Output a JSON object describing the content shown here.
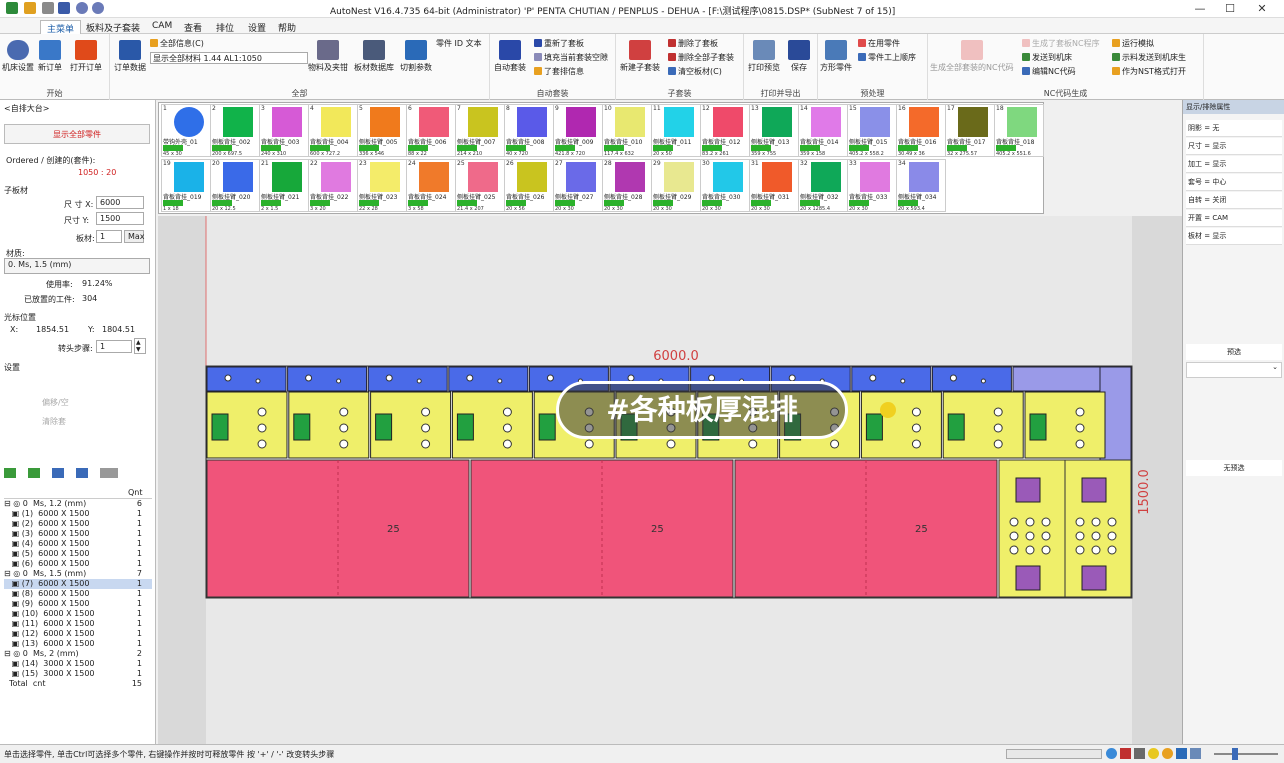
{
  "window": {
    "title": "AutoNest V16.4.735 64-bit (Administrator)  'P'  PENTA  CHUTIAN / PENPLUS        - DEHUA - [F:\\测试程序\\0815.DSP* (SubNest 7 of 15)]"
  },
  "tabs": [
    "主菜单",
    "板料及子套装",
    "CAM",
    "查看",
    "排位",
    "设置",
    "帮助"
  ],
  "ribbon": {
    "start": {
      "label": "开始",
      "buttons": [
        "机床设置",
        "新订单",
        "打开订单"
      ]
    },
    "all": {
      "label": "全部",
      "order_data": "订单数据",
      "all_info": "全部信息(C)",
      "combo_value": "显示全部材料    1.44 AL1:1050",
      "buttons": [
        "物料及夹钳",
        "板材数据库",
        "切割参数"
      ],
      "part_id": "零件 ID 文本"
    },
    "autonest": {
      "label": "自动套装",
      "big": "自动套装",
      "items": [
        "重新了套板",
        "填充当前套装空隙",
        "了套排信息"
      ]
    },
    "subnest": {
      "label": "子套装",
      "big": "新建子套装",
      "items": [
        "删除了套板",
        "删除全部子套装",
        "清空板材(C)"
      ]
    },
    "print": {
      "label": "打印并导出",
      "buttons": [
        "打印预览",
        "保存"
      ]
    },
    "preprocess": {
      "label": "预处理",
      "big": "方形零件",
      "items": [
        "在用零件",
        "零件工上顺序"
      ]
    },
    "nc": {
      "label": "NC代码生成",
      "big": "生成全部套装的NC代码",
      "items": [
        "生成了套板NC程序",
        "发送到机床",
        "编辑NC代码",
        "运行模拟",
        "示料发送到机床生",
        "作为NST格式打开"
      ]
    }
  },
  "left": {
    "header": "<自排大台>",
    "red_button": "显示全部零件",
    "ordered_label": "Ordered / 创建的(套件):",
    "ordered_value": "1050 : 20",
    "sheet_section": "子板材",
    "size_x_label": "尺 寸 X:",
    "size_x": "6000",
    "size_y_label": "尺寸 Y:",
    "size_y": "1500",
    "material_label": "板材:",
    "material": "1",
    "max_btn": "Max",
    "material_section": "材质:",
    "material_value": "0. Ms, 1.5 (mm)",
    "usage_label": "使用率:",
    "usage": "91.24%",
    "placed_label": "已放置的工件:",
    "placed": "304",
    "cursor_section": "光标位置",
    "x_label": "X:",
    "x": "1854.51",
    "y_label": "Y:",
    "y": "1804.51",
    "step_label": "转头步骤:",
    "step": "1",
    "settings_section": "设置",
    "grey1": "偏移/空",
    "grey2": "清除套",
    "tree_header": "Qnt",
    "tree": [
      {
        "t": "⊟ ◎ 0  Ms, 1.2 (mm)",
        "q": "6"
      },
      {
        "t": "   ▣ (1)  6000 X 1500",
        "q": "1"
      },
      {
        "t": "   ▣ (2)  6000 X 1500",
        "q": "1"
      },
      {
        "t": "   ▣ (3)  6000 X 1500",
        "q": "1"
      },
      {
        "t": "   ▣ (4)  6000 X 1500",
        "q": "1"
      },
      {
        "t": "   ▣ (5)  6000 X 1500",
        "q": "1"
      },
      {
        "t": "   ▣ (6)  6000 X 1500",
        "q": "1"
      },
      {
        "t": "⊟ ◎ 0  Ms, 1.5 (mm)",
        "q": "7"
      },
      {
        "t": "   ▣ (7)  6000 X 1500",
        "q": "1"
      },
      {
        "t": "   ▣ (8)  6000 X 1500",
        "q": "1"
      },
      {
        "t": "   ▣ (9)  6000 X 1500",
        "q": "1"
      },
      {
        "t": "   ▣ (10)  6000 X 1500",
        "q": "1"
      },
      {
        "t": "   ▣ (11)  6000 X 1500",
        "q": "1"
      },
      {
        "t": "   ▣ (12)  6000 X 1500",
        "q": "1"
      },
      {
        "t": "   ▣ (13)  6000 X 1500",
        "q": "1"
      },
      {
        "t": "⊟ ◎ 0  Ms, 2 (mm)",
        "q": "2"
      },
      {
        "t": "   ▣ (14)  3000 X 1500",
        "q": "1"
      },
      {
        "t": "   ▣ (15)  3000 X 1500",
        "q": "1"
      },
      {
        "t": "  Total  cnt",
        "q": "15"
      }
    ]
  },
  "parts_row1": [
    {
      "n": "1",
      "lab": "带钩外壳_01",
      "dim": "45 x 30",
      "c": "#2f6fe8"
    },
    {
      "n": "2",
      "lab": "侧板背挂_002",
      "dim": "200 x 697.5",
      "c": "#11b34a"
    },
    {
      "n": "3",
      "lab": "背板背挂_003",
      "dim": "240 x 310",
      "c": "#d65ad6"
    },
    {
      "n": "4",
      "lab": "背板背挂_004",
      "dim": "600 x 727.2",
      "c": "#f2e85a"
    },
    {
      "n": "5",
      "lab": "侧板挂臂_005",
      "dim": "336 x 546",
      "c": "#f07a1c"
    },
    {
      "n": "6",
      "lab": "背板背挂_006",
      "dim": "88 x 22",
      "c": "#f05a78"
    },
    {
      "n": "7",
      "lab": "侧板挂臂_007",
      "dim": "214 x 210",
      "c": "#c9c41f"
    },
    {
      "n": "8",
      "lab": "背板背挂_008",
      "dim": "40 x 720",
      "c": "#5a5ae8"
    },
    {
      "n": "9",
      "lab": "背板挂臂_009",
      "dim": "421.8 x 720",
      "c": "#b028b0"
    },
    {
      "n": "10",
      "lab": "背板背挂_010",
      "dim": "117.4 x 632",
      "c": "#e8e870"
    },
    {
      "n": "11",
      "lab": "侧板挂臂_011",
      "dim": "20 x 50",
      "c": "#22d2e8"
    },
    {
      "n": "12",
      "lab": "背板背挂_012",
      "dim": "83.2 x 261",
      "c": "#ef4a6a"
    },
    {
      "n": "13",
      "lab": "侧板挂臂_013",
      "dim": "359 x 755",
      "c": "#0fa858"
    },
    {
      "n": "14",
      "lab": "背板背挂_014",
      "dim": "359 x 158",
      "c": "#e07ae8"
    },
    {
      "n": "15",
      "lab": "侧板挂臂_015",
      "dim": "405.2 x 558.2",
      "c": "#8a90e8"
    },
    {
      "n": "16",
      "lab": "背板背挂_016",
      "dim": "30.49 x 36",
      "c": "#f46a2a"
    },
    {
      "n": "17",
      "lab": "背板背挂_017",
      "dim": "32 x 275.57",
      "c": "#6a6a1a"
    },
    {
      "n": "18",
      "lab": "背板背挂_018",
      "dim": "405.2 x 551.6",
      "c": "#7fd87f"
    }
  ],
  "parts_row2": [
    {
      "n": "19",
      "lab": "背板背挂_019",
      "dim": "1 x 18",
      "c": "#1ab2e8"
    },
    {
      "n": "20",
      "lab": "侧板挂臂_020",
      "dim": "20 x 12.5",
      "c": "#3a6ae8"
    },
    {
      "n": "21",
      "lab": "侧板挂臂_021",
      "dim": "2 x 1.5",
      "c": "#17a83a"
    },
    {
      "n": "22",
      "lab": "背板背挂_022",
      "dim": "3 x 20",
      "c": "#e07ae0"
    },
    {
      "n": "23",
      "lab": "侧板挂臂_023",
      "dim": "22 x 28",
      "c": "#f4ec6a"
    },
    {
      "n": "24",
      "lab": "背板背挂_024",
      "dim": "3 x 58",
      "c": "#f07a2a"
    },
    {
      "n": "25",
      "lab": "侧板挂臂_025",
      "dim": "21.4 x 207",
      "c": "#ef6a8a"
    },
    {
      "n": "26",
      "lab": "背板背挂_026",
      "dim": "20 x 56",
      "c": "#c9c41f"
    },
    {
      "n": "27",
      "lab": "侧板挂臂_027",
      "dim": "20 x 30",
      "c": "#6a6ae8"
    },
    {
      "n": "28",
      "lab": "侧板背挂_028",
      "dim": "20 x 30",
      "c": "#b038b0"
    },
    {
      "n": "29",
      "lab": "侧板挂臂_029",
      "dim": "20 x 30",
      "c": "#e8e890"
    },
    {
      "n": "30",
      "lab": "背板背挂_030",
      "dim": "20 x 30",
      "c": "#22c8e8"
    },
    {
      "n": "31",
      "lab": "侧板挂臂_031",
      "dim": "20 x 30",
      "c": "#f05a2a"
    },
    {
      "n": "32",
      "lab": "侧板挂臂_032",
      "dim": "20 x 1285.4",
      "c": "#0fa858"
    },
    {
      "n": "33",
      "lab": "背板背挂_033",
      "dim": "20 x 30",
      "c": "#e07ae0"
    },
    {
      "n": "34",
      "lab": "侧板挂臂_034",
      "dim": "20 x 593.4",
      "c": "#8a8ae8"
    }
  ],
  "canvas": {
    "width_label": "6000.0",
    "height_label": "1500.0",
    "part_number": "25",
    "overlay": "#各种板厚混排"
  },
  "right": {
    "header": "显示/排除属性",
    "rows": [
      "阴影 = 无",
      "尺寸 = 显示",
      "加工 = 显示",
      "套号 = 中心",
      "自转 = 关闭",
      "开置 = CAM",
      "板材 = 显示"
    ],
    "sec1": "预选",
    "sec2": "无预选"
  },
  "status": {
    "text": "单击选择零件, 单击Ctrl可选择多个零件, 右键操作并按时可释放零件 按 '+' / '-' 改变转头步骤"
  }
}
